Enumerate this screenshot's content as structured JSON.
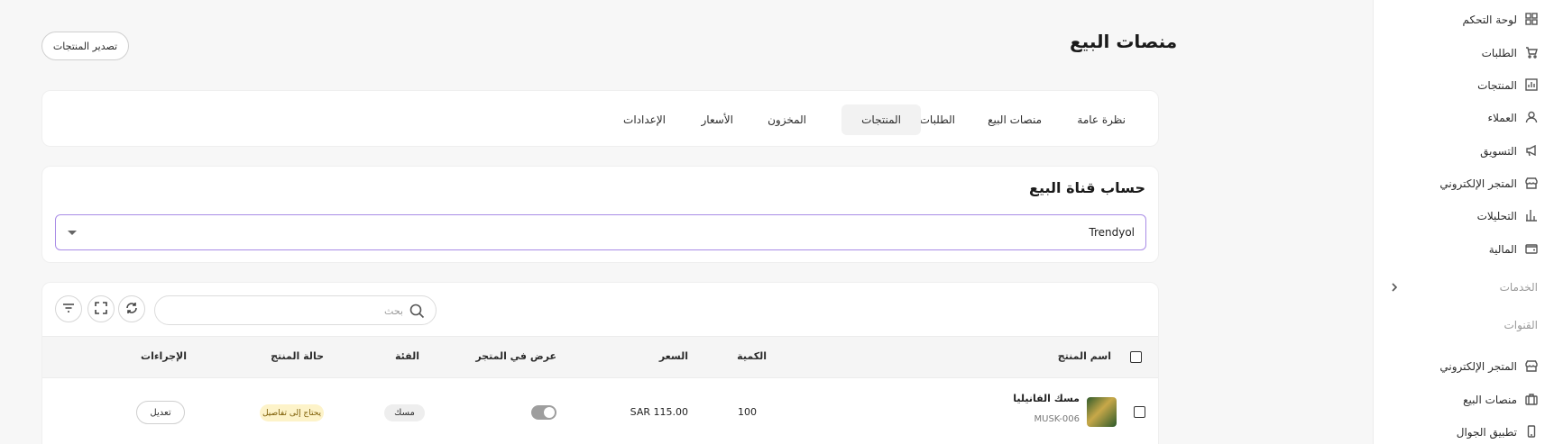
{
  "sidebar": {
    "items": [
      {
        "label": "لوحة التحكم",
        "icon": "grid-icon"
      },
      {
        "label": "الطلبات",
        "icon": "cart-icon"
      },
      {
        "label": "المنتجات",
        "icon": "chart-box-icon"
      },
      {
        "label": "العملاء",
        "icon": "user-icon"
      },
      {
        "label": "التسويق",
        "icon": "megaphone-icon"
      },
      {
        "label": "المتجر الإلكتروني",
        "icon": "store-icon"
      },
      {
        "label": "التحليلات",
        "icon": "bar-chart-icon"
      },
      {
        "label": "المالية",
        "icon": "wallet-icon"
      }
    ],
    "services_label": "الخدمات",
    "channels_label": "القنوات",
    "channels": [
      {
        "label": "المتجر الإلكتروني",
        "icon": "store-icon"
      },
      {
        "label": "منصات البيع",
        "icon": "briefcase-icon"
      },
      {
        "label": "تطبيق الجوال",
        "icon": "phone-icon"
      }
    ]
  },
  "header": {
    "title": "منصات البيع",
    "export_label": "تصدير المنتجات"
  },
  "tabs": [
    {
      "label": "نظرة عامة",
      "active": false
    },
    {
      "label": "منصات البيع",
      "active": false
    },
    {
      "label": "الطلبات",
      "active": false
    },
    {
      "label": "المنتجات",
      "active": true
    },
    {
      "label": "المخزون",
      "active": false
    },
    {
      "label": "الأسعار",
      "active": false
    },
    {
      "label": "الإعدادات",
      "active": false
    }
  ],
  "account": {
    "title": "حساب قناة البيع",
    "selected": "Trendyol"
  },
  "toolbar": {
    "search_placeholder": "بحث"
  },
  "table": {
    "columns": [
      "اسم المنتج",
      "الكمية",
      "السعر",
      "عرض في المتجر",
      "الفئة",
      "حالة المنتج",
      "الإجراءات"
    ],
    "rows": [
      {
        "name": "مسك الفانيليا",
        "sku": "MUSK-006",
        "quantity": "100",
        "price": "SAR 115.00",
        "show_in_store": true,
        "category": "مسك",
        "status": "يحتاج إلى تفاصيل",
        "action": "تعديل"
      }
    ]
  },
  "colors": {
    "accent_border": "#a98ce6",
    "status_badge_bg": "#fdf3c9"
  }
}
